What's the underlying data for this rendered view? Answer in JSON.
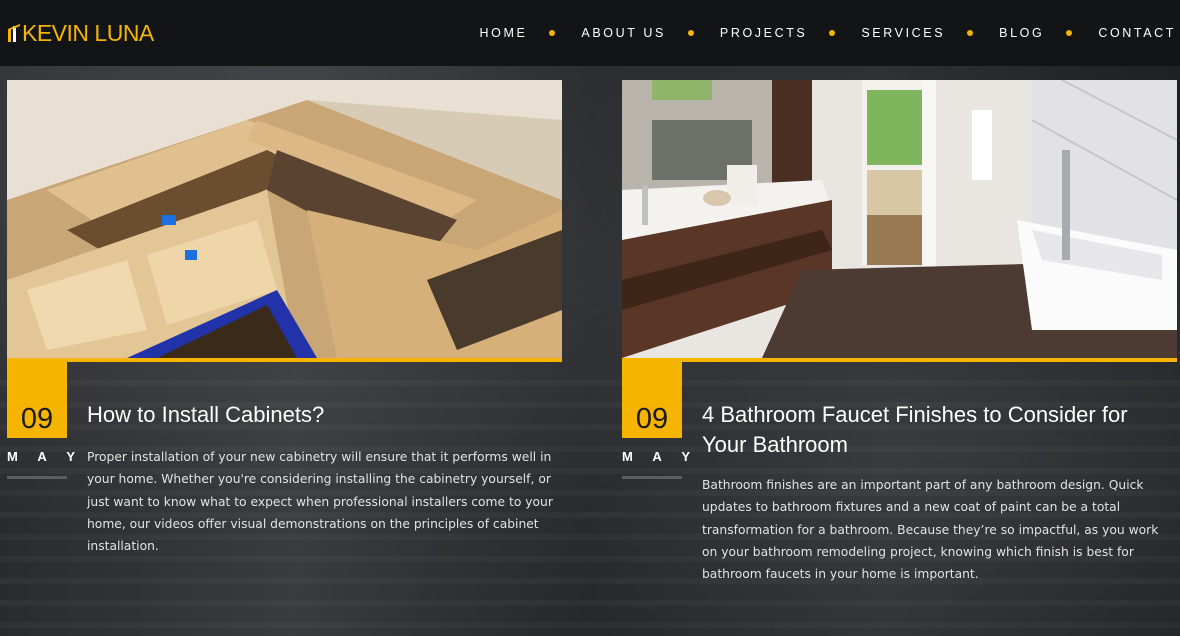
{
  "header": {
    "logo": "KEVIN LUNA",
    "nav": [
      "HOME",
      "ABOUT US",
      "PROJECTS",
      "SERVICES",
      "BLOG",
      "CONTACT"
    ]
  },
  "colors": {
    "accent": "#f5b400",
    "header_bg": "#131416"
  },
  "posts": [
    {
      "day": "09",
      "month": [
        "M",
        "A",
        "Y"
      ],
      "title": "How to Install Cabinets?",
      "excerpt": "Proper installation of your new cabinetry will ensure that it performs well in your home. Whether you're considering installing the cabinetry yourself, or just want to know what to expect when professional installers come to your home, our videos offer visual demonstrations on the principles of cabinet installation."
    },
    {
      "day": "09",
      "month": [
        "M",
        "A",
        "Y"
      ],
      "title": "4 Bathroom Faucet Finishes to Consider for Your Bathroom",
      "excerpt": "Bathroom finishes are an important part of any bathroom design. Quick updates to bathroom fixtures and a new coat of paint can be a total transformation for a bathroom. Because they’re so impactful, as you work on your bathroom remodeling project, knowing which finish is best for bathroom faucets in your home is important."
    }
  ]
}
